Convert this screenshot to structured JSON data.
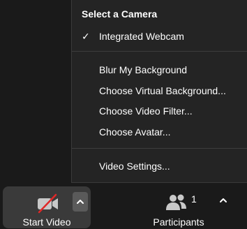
{
  "camera_menu": {
    "title": "Select a Camera",
    "selected_camera": "Integrated Webcam",
    "check_glyph": "✓",
    "items": [
      {
        "label": "Blur My Background"
      },
      {
        "label": "Choose Virtual Background..."
      },
      {
        "label": "Choose Video Filter..."
      },
      {
        "label": "Choose Avatar..."
      }
    ],
    "settings_label": "Video Settings..."
  },
  "toolbar": {
    "start_video_label": "Start Video",
    "start_video_icon": "video-off-icon",
    "start_video_caret": "^",
    "participants_label": "Participants",
    "participants_icon": "participants-icon",
    "participant_count": "1",
    "participants_caret": "^"
  },
  "colors": {
    "background": "#1a1a1a",
    "menu_background": "#242424",
    "active_button": "#3a3a3a",
    "video_off_slash": "#e02828",
    "text": "#ffffff"
  }
}
